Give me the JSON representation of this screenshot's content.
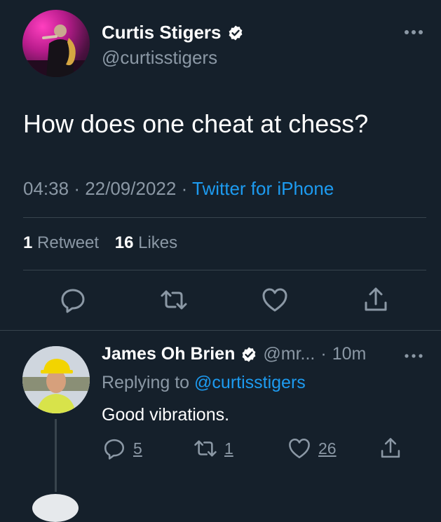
{
  "main_tweet": {
    "author_name": "Curtis Stigers",
    "author_handle": "@curtisstigers",
    "text": "How does one cheat at chess?",
    "time": "04:38",
    "date": "22/09/2022",
    "source": "Twitter for iPhone",
    "stats": {
      "retweet_count": "1",
      "retweet_label": "Retweet",
      "like_count": "16",
      "like_label": "Likes"
    },
    "actions": [
      "reply-icon",
      "retweet-icon",
      "like-icon",
      "share-icon"
    ]
  },
  "reply": {
    "author_name": "James Oh Brien",
    "author_handle": "@mr...",
    "time": "10m",
    "replying_prefix": "Replying to",
    "replying_to": "@curtisstigers",
    "text": "Good vibrations.",
    "reply_count": "5",
    "retweet_count": "1",
    "like_count": "26"
  },
  "colors": {
    "background": "#15202b",
    "primary_text": "#ffffff",
    "secondary_text": "#8b98a5",
    "accent": "#1d9bf0",
    "divider": "#38444d"
  }
}
